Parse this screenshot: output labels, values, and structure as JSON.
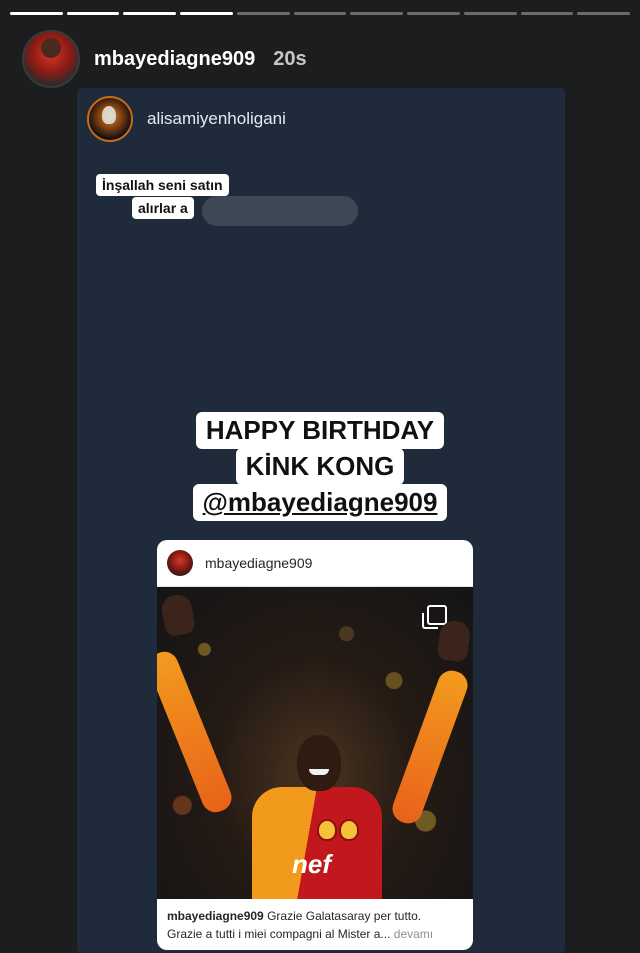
{
  "story": {
    "segments_total": 11,
    "segments_viewed": 4,
    "username": "mbayediagne909",
    "time": "20s"
  },
  "reshared": {
    "username": "alisamiyenholigani",
    "sticker_lines": [
      "İnşallah seni satın",
      "alırlar a"
    ],
    "birthday_lines": [
      "HAPPY BIRTHDAY",
      "KİNK KONG",
      "@mbayediagne909"
    ]
  },
  "post": {
    "username": "mbayediagne909",
    "sponsor_text": "nef",
    "caption_user": "mbayediagne909",
    "caption_text": "Grazie Galatasaray per tutto.",
    "caption_line2": "Grazie a tutti i miei compagni al Mister a...",
    "more_label": "devamı"
  },
  "colors": {
    "story_background": "#1c1d1f",
    "reshared_background": "#1f2b3a",
    "jersey_orange": "#f29a1c",
    "jersey_red": "#c2181d"
  },
  "icons": {
    "multi_image": "multiple-photos-icon"
  }
}
